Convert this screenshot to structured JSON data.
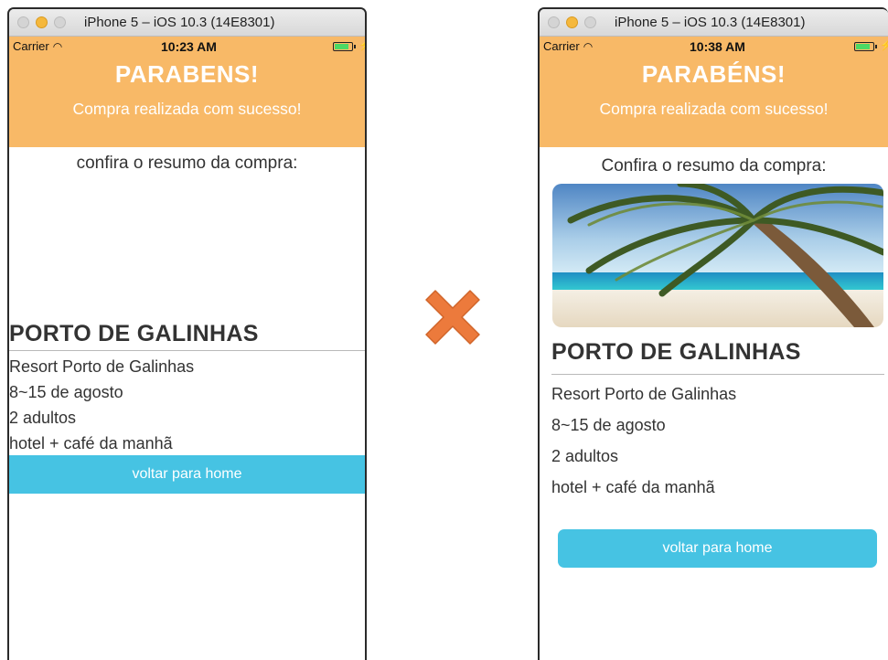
{
  "left": {
    "window_title": "iPhone 5 – iOS 10.3 (14E8301)",
    "carrier": "Carrier",
    "time": "10:23 AM",
    "header_title": "PARABENS!",
    "header_subtitle": "Compra realizada com sucesso!",
    "summary_label": "confira o resumo da compra:",
    "destination": "PORTO DE GALINHAS",
    "details": [
      "Resort Porto de Galinhas",
      "8~15 de agosto",
      "2 adultos",
      "hotel + café da manhã"
    ],
    "button_label": "voltar para home"
  },
  "right": {
    "window_title": "iPhone 5 – iOS 10.3 (14E8301)",
    "carrier": "Carrier",
    "time": "10:38 AM",
    "header_title": "PARABÉNS!",
    "header_subtitle": "Compra realizada com sucesso!",
    "summary_label": "Confira o resumo da compra:",
    "destination": "PORTO DE GALINHAS",
    "details": [
      "Resort Porto de Galinhas",
      "8~15 de agosto",
      "2 adultos",
      "hotel + café da manhã"
    ],
    "button_label": "voltar para home"
  },
  "colors": {
    "header": "#f8b967",
    "button": "#46c3e3",
    "cross": "#ec7a3c"
  },
  "icons": [
    "wifi-icon",
    "battery-icon",
    "charging-bolt-icon",
    "cross-icon",
    "beach-photo"
  ]
}
